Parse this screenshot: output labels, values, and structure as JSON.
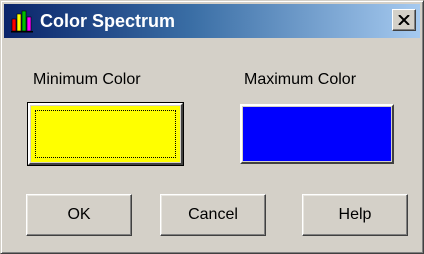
{
  "window": {
    "title": "Color Spectrum",
    "icon": "bar-chart-icon",
    "close_glyph": "close-icon"
  },
  "minimum": {
    "label": "Minimum Color",
    "color": "#ffff00"
  },
  "maximum": {
    "label": "Maximum Color",
    "color": "#0000ff"
  },
  "buttons": {
    "ok": "OK",
    "cancel": "Cancel",
    "help": "Help"
  }
}
